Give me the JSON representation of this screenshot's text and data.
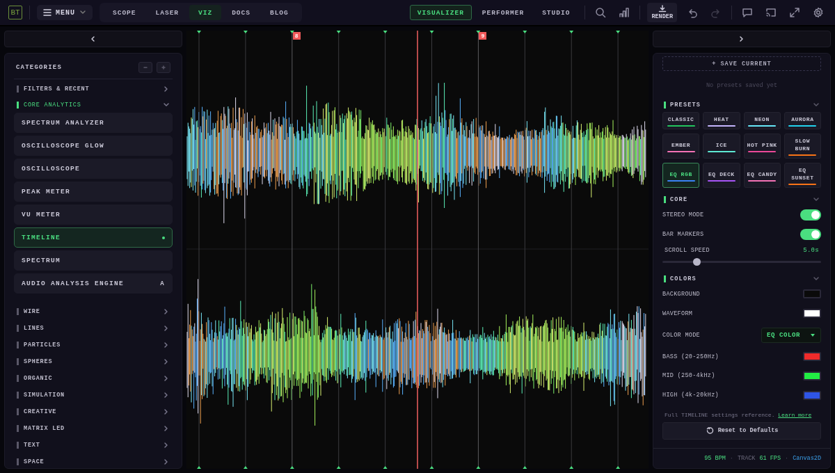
{
  "topbar": {
    "logo": "BT",
    "menu": "MENU",
    "nav_tabs": [
      {
        "label": "SCOPE",
        "selected": false
      },
      {
        "label": "LASER",
        "selected": false
      },
      {
        "label": "VIZ",
        "selected": true
      },
      {
        "label": "DOCS",
        "selected": false
      },
      {
        "label": "BLOG",
        "selected": false
      }
    ],
    "mode_tabs": [
      {
        "label": "VISUALIZER",
        "selected": true
      },
      {
        "label": "PERFORMER",
        "selected": false
      },
      {
        "label": "STUDIO",
        "selected": false
      }
    ],
    "tools": [
      {
        "kind": "search",
        "disabled": false
      },
      {
        "kind": "chart",
        "disabled": false
      },
      {
        "kind": "render",
        "label": "RENDER",
        "disabled": false
      },
      {
        "kind": "undo",
        "disabled": false
      },
      {
        "kind": "redo",
        "disabled": true
      },
      {
        "kind": "chat",
        "disabled": false
      },
      {
        "kind": "cast",
        "disabled": false
      },
      {
        "kind": "expand",
        "disabled": false
      },
      {
        "kind": "settings",
        "disabled": false
      }
    ]
  },
  "sidebar": {
    "title": "CATEGORIES",
    "categories": [
      {
        "label": "FILTERS & RECENT",
        "expanded": false
      },
      {
        "label": "CORE ANALYTICS",
        "expanded": true,
        "children": [
          {
            "label": "SPECTRUM ANALYZER",
            "selected": false
          },
          {
            "label": "OSCILLOSCOPE GLOW",
            "selected": false
          },
          {
            "label": "OSCILLOSCOPE",
            "selected": false
          },
          {
            "label": "PEAK METER",
            "selected": false
          },
          {
            "label": "VU METER",
            "selected": false
          },
          {
            "label": "TIMELINE",
            "selected": true
          },
          {
            "label": "SPECTRUM",
            "selected": false
          },
          {
            "label": "AUDIO ANALYSIS ENGINE",
            "selected": false,
            "badge": "A"
          }
        ]
      },
      {
        "label": "WIRE",
        "expanded": false
      },
      {
        "label": "LINES",
        "expanded": false
      },
      {
        "label": "PARTICLES",
        "expanded": false
      },
      {
        "label": "SPHERES",
        "expanded": false
      },
      {
        "label": "ORGANIC",
        "expanded": false
      },
      {
        "label": "SIMULATION",
        "expanded": false
      },
      {
        "label": "CREATIVE",
        "expanded": false
      },
      {
        "label": "MATRIX LED",
        "expanded": false
      },
      {
        "label": "TEXT",
        "expanded": false
      },
      {
        "label": "SPACE",
        "expanded": false
      }
    ]
  },
  "visualizer": {
    "markers": [
      {
        "kind": "beat"
      },
      {
        "kind": "beat"
      },
      {
        "kind": "bar",
        "label": "8"
      },
      {
        "kind": "beat"
      },
      {
        "kind": "beat"
      },
      {
        "kind": "beat"
      },
      {
        "kind": "bar",
        "label": "9"
      },
      {
        "kind": "beat"
      },
      {
        "kind": "beat"
      },
      {
        "kind": "beat"
      }
    ]
  },
  "settings": {
    "save_button": "+ SAVE CURRENT",
    "empty_note": "No presets saved yet",
    "presets": {
      "title": "PRESETS",
      "expanded": true,
      "items": [
        {
          "label": "CLASSIC",
          "selected": false,
          "color": "#22c55e"
        },
        {
          "label": "HEAT",
          "selected": false,
          "color": "#c4b5fd"
        },
        {
          "label": "NEON",
          "selected": false,
          "color": "#67e8f9"
        },
        {
          "label": "AURORA",
          "selected": false,
          "color": "#22d3ee"
        },
        {
          "label": "EMBER",
          "selected": false,
          "color": "#f472b6"
        },
        {
          "label": "ICE",
          "selected": false,
          "color": "#5eead4"
        },
        {
          "label": "HOT PINK",
          "selected": false,
          "color": "#ec4899"
        },
        {
          "label": "SLOW BURN",
          "selected": false,
          "color": "#f97316"
        },
        {
          "label": "EQ RGB",
          "selected": true,
          "color": "#3b82f6"
        },
        {
          "label": "EQ DECK",
          "selected": false,
          "color": "#a855f7"
        },
        {
          "label": "EQ CANDY",
          "selected": false,
          "color": "#f472b6"
        },
        {
          "label": "EQ SUNSET",
          "selected": false,
          "color": "#f97316"
        }
      ]
    },
    "core": {
      "title": "CORE",
      "expanded": true,
      "toggles": [
        {
          "label": "STEREO MODE",
          "on": true
        },
        {
          "label": "BAR MARKERS",
          "on": true
        }
      ],
      "slider": {
        "label": "SCROLL SPEED",
        "reading": "5.0s",
        "level": 0.22
      }
    },
    "colors": {
      "title": "COLORS",
      "expanded": true,
      "rows": [
        {
          "kind": "swatch",
          "label": "BACKGROUND",
          "color": "#0a0a0a"
        },
        {
          "kind": "swatch",
          "label": "WAVEFORM",
          "color": "#ffffff"
        },
        {
          "kind": "dropdown",
          "label": "COLOR MODE",
          "value": "EQ COLOR"
        },
        {
          "kind": "swatch",
          "label": "BASS (20-250Hz)",
          "color": "#ef2b2b"
        },
        {
          "kind": "swatch",
          "label": "MID (250-4kHz)",
          "color": "#22ee44"
        },
        {
          "kind": "swatch",
          "label": "HIGH (4k-20kHz)",
          "color": "#2f55e6"
        }
      ]
    },
    "note": {
      "text": "Full TIMELINE settings reference.",
      "link": "Learn more"
    },
    "reset": "Reset to Defaults",
    "status": [
      {
        "kind": "accent",
        "text": "95 BPM"
      },
      {
        "kind": "sep",
        "text": "·"
      },
      {
        "kind": "muted",
        "text": "TRACK"
      },
      {
        "kind": "accent",
        "text": "61 FPS"
      },
      {
        "kind": "sep",
        "text": "·"
      },
      {
        "kind": "link",
        "text": "Canvas2D"
      }
    ]
  }
}
